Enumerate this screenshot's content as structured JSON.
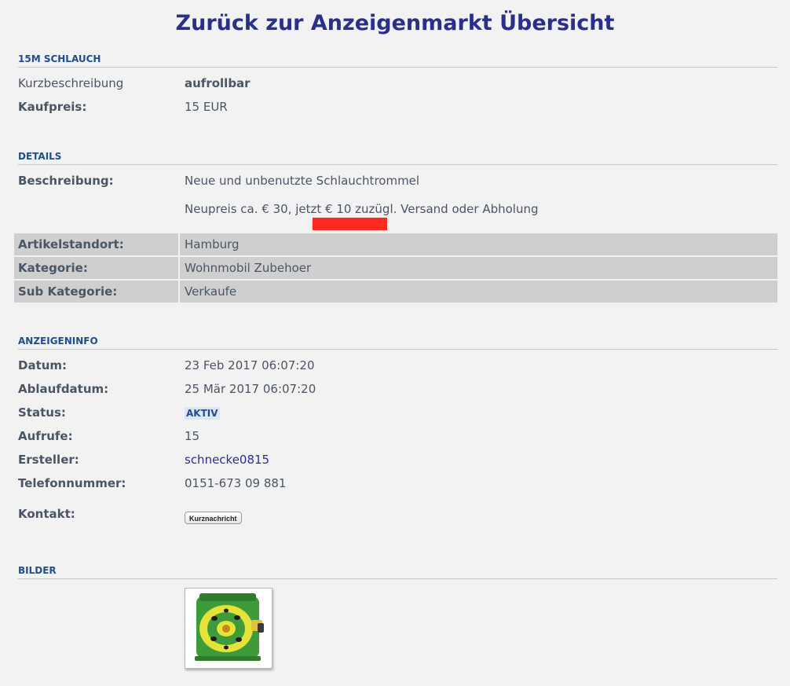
{
  "header": {
    "title": "Zurück zur Anzeigenmarkt Übersicht"
  },
  "summary": {
    "heading": "15M SCHLAUCH",
    "short_label": "Kurzbeschreibung",
    "short_value": "aufrollbar",
    "price_label": "Kaufpreis:",
    "price_value": "15 EUR"
  },
  "details": {
    "heading": "DETAILS",
    "description_label": "Beschreibung:",
    "description_line1": "Neue und unbenutzte Schlauchtrommel",
    "description_line2": "Neupreis ca. € 30, jetzt € 10 zuzügl. Versand oder Abholung",
    "location_label": "Artikelstandort:",
    "location_value": "Hamburg",
    "category_label": "Kategorie:",
    "category_value": "Wohnmobil Zubehoer",
    "subcategory_label": "Sub Kategorie:",
    "subcategory_value": "Verkaufe"
  },
  "adinfo": {
    "heading": "ANZEIGENINFO",
    "date_label": "Datum:",
    "date_value": "23 Feb 2017 06:07:20",
    "expiry_label": "Ablaufdatum:",
    "expiry_value": "25 Mär 2017 06:07:20",
    "status_label": "Status:",
    "status_value": "AKTIV",
    "views_label": "Aufrufe:",
    "views_value": "15",
    "creator_label": "Ersteller:",
    "creator_value": "schnecke0815",
    "phone_label": "Telefonnummer:",
    "phone_value": "0151-673 09 881",
    "contact_label": "Kontakt:",
    "contact_button": "Kurznachricht"
  },
  "images": {
    "heading": "BILDER"
  },
  "colors": {
    "accent": "#2b2f8c",
    "section": "#1f4e8c",
    "redaction": "#ff2a1f",
    "reel_green": "#3f9a3a",
    "reel_yellow": "#e3e33a"
  }
}
